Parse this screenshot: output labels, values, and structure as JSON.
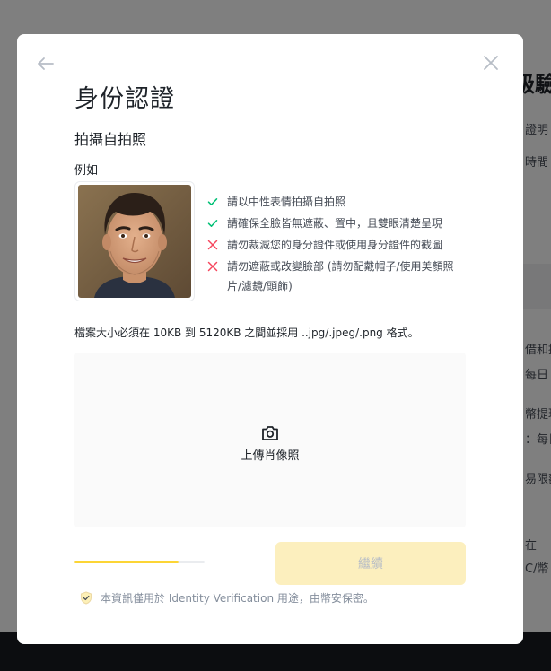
{
  "background": {
    "title_fragment": "級驗",
    "text_fragments": [
      "證明",
      "時間",
      "借和提",
      "每日",
      "幣提現",
      "：每日",
      "易限額",
      "在",
      "C/幣"
    ]
  },
  "modal": {
    "title": "身份認證",
    "subtitle": "拍攝自拍照",
    "example_label": "例如",
    "rules": [
      {
        "status": "ok",
        "text": "請以中性表情拍攝自拍照"
      },
      {
        "status": "ok",
        "text": "請確保全臉皆無遮蔽、置中，且雙眼清楚呈現"
      },
      {
        "status": "bad",
        "text": "請勿裁減您的身分證件或使用身分證件的截圖"
      },
      {
        "status": "bad",
        "text": "請勿遮蔽或改變臉部 (請勿配戴帽子/使用美顏照片/濾鏡/頭飾)"
      }
    ],
    "file_size_note": "檔案大小必須在 10KB 到 5120KB 之間並採用 ..jpg/.jpeg/.png 格式。",
    "upload_label": "上傳肖像照",
    "progress": 0.8,
    "continue_label": "繼續",
    "privacy_note": "本資訊僅用於 Identity Verification 用途，由幣安保密。"
  },
  "icons": {
    "back": "arrow-left-icon",
    "close": "close-icon",
    "ok": "checkmark-icon",
    "bad": "cross-icon",
    "camera": "camera-icon",
    "shield": "shield-check-icon"
  },
  "colors": {
    "ok": "#02c076",
    "bad": "#f6465d",
    "accent": "#fcd535",
    "button_disabled_bg": "#fcefbe"
  }
}
